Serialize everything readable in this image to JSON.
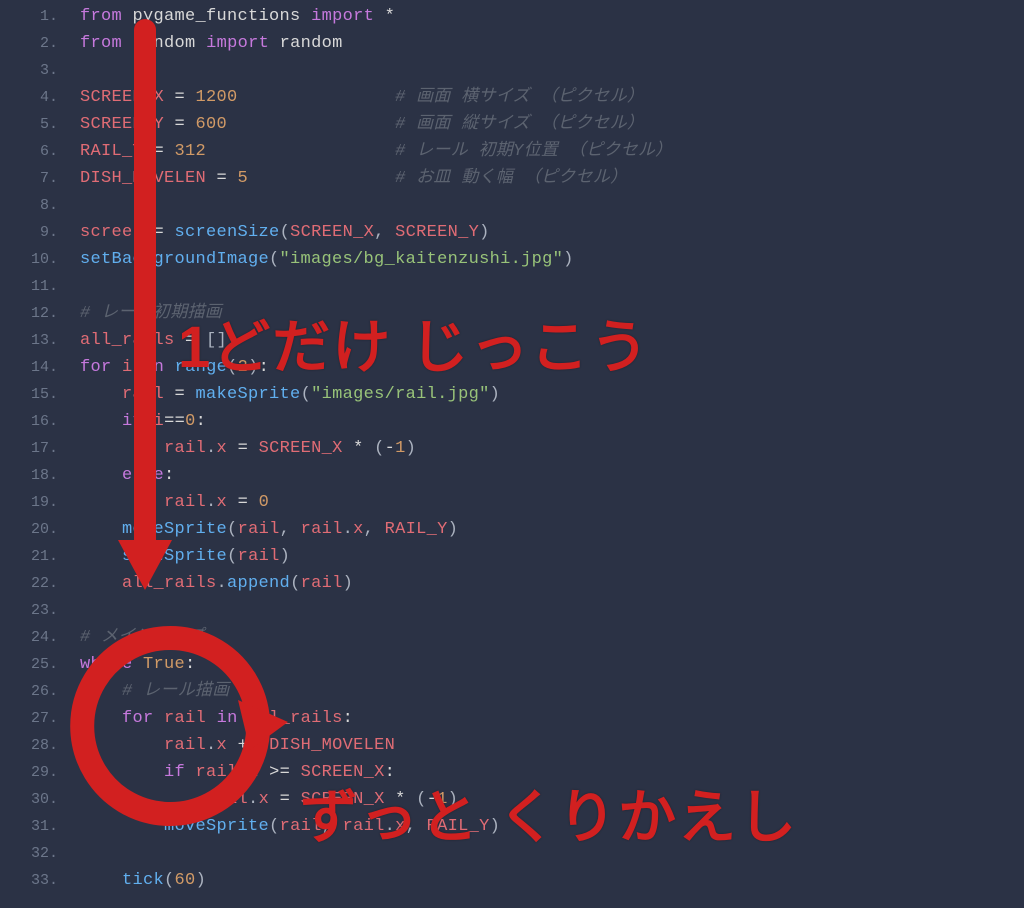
{
  "annotations": {
    "top": "1どだけ じっこう",
    "bottom": "ずっと くりかえし"
  },
  "lines": [
    {
      "n": "1.",
      "tokens": [
        [
          "kw",
          "from"
        ],
        [
          "op",
          " "
        ],
        [
          "mod",
          "pygame_functions"
        ],
        [
          "op",
          " "
        ],
        [
          "kw",
          "import"
        ],
        [
          "op",
          " "
        ],
        [
          "op",
          "*"
        ]
      ]
    },
    {
      "n": "2.",
      "tokens": [
        [
          "kw",
          "from"
        ],
        [
          "op",
          " "
        ],
        [
          "mod",
          "random"
        ],
        [
          "op",
          " "
        ],
        [
          "kw",
          "import"
        ],
        [
          "op",
          " "
        ],
        [
          "mod",
          "random"
        ]
      ]
    },
    {
      "n": "3.",
      "tokens": []
    },
    {
      "n": "4.",
      "tokens": [
        [
          "var",
          "SCREEN_X"
        ],
        [
          "op",
          " = "
        ],
        [
          "num",
          "1200"
        ],
        [
          "op",
          "               "
        ],
        [
          "cmt",
          "# 画面 横サイズ （ピクセル）"
        ]
      ]
    },
    {
      "n": "5.",
      "tokens": [
        [
          "var",
          "SCREEN_Y"
        ],
        [
          "op",
          " = "
        ],
        [
          "num",
          "600"
        ],
        [
          "op",
          "                "
        ],
        [
          "cmt",
          "# 画面 縦サイズ （ピクセル）"
        ]
      ]
    },
    {
      "n": "6.",
      "tokens": [
        [
          "var",
          "RAIL_Y"
        ],
        [
          "op",
          " = "
        ],
        [
          "num",
          "312"
        ],
        [
          "op",
          "                  "
        ],
        [
          "cmt",
          "# レール 初期Y位置 （ピクセル）"
        ]
      ]
    },
    {
      "n": "7.",
      "tokens": [
        [
          "var",
          "DISH_MOVELEN"
        ],
        [
          "op",
          " = "
        ],
        [
          "num",
          "5"
        ],
        [
          "op",
          "              "
        ],
        [
          "cmt",
          "# お皿 動く幅 （ピクセル）"
        ]
      ]
    },
    {
      "n": "8.",
      "tokens": []
    },
    {
      "n": "9.",
      "tokens": [
        [
          "var",
          "screen"
        ],
        [
          "op",
          " = "
        ],
        [
          "fn",
          "screenSize"
        ],
        [
          "punc",
          "("
        ],
        [
          "var",
          "SCREEN_X"
        ],
        [
          "punc",
          ", "
        ],
        [
          "var",
          "SCREEN_Y"
        ],
        [
          "punc",
          ")"
        ]
      ]
    },
    {
      "n": "10.",
      "tokens": [
        [
          "fn",
          "setBackgroundImage"
        ],
        [
          "punc",
          "("
        ],
        [
          "str",
          "\"images/bg_kaitenzushi.jpg\""
        ],
        [
          "punc",
          ")"
        ]
      ]
    },
    {
      "n": "11.",
      "tokens": []
    },
    {
      "n": "12.",
      "tokens": [
        [
          "cmt",
          "# レール初期描画"
        ]
      ]
    },
    {
      "n": "13.",
      "tokens": [
        [
          "var",
          "all_rails"
        ],
        [
          "op",
          " = "
        ],
        [
          "punc",
          "[]"
        ]
      ]
    },
    {
      "n": "14.",
      "tokens": [
        [
          "kw",
          "for"
        ],
        [
          "op",
          " "
        ],
        [
          "var",
          "i"
        ],
        [
          "op",
          " "
        ],
        [
          "kw",
          "in"
        ],
        [
          "op",
          " "
        ],
        [
          "fn",
          "range"
        ],
        [
          "punc",
          "("
        ],
        [
          "num",
          "2"
        ],
        [
          "punc",
          ")"
        ],
        [
          "op",
          ":"
        ]
      ]
    },
    {
      "n": "15.",
      "tokens": [
        [
          "op",
          "    "
        ],
        [
          "var",
          "rail"
        ],
        [
          "op",
          " = "
        ],
        [
          "fn",
          "makeSprite"
        ],
        [
          "punc",
          "("
        ],
        [
          "str",
          "\"images/rail.jpg\""
        ],
        [
          "punc",
          ")"
        ]
      ]
    },
    {
      "n": "16.",
      "tokens": [
        [
          "op",
          "    "
        ],
        [
          "kw",
          "if"
        ],
        [
          "op",
          " "
        ],
        [
          "var",
          "i"
        ],
        [
          "op",
          "=="
        ],
        [
          "num",
          "0"
        ],
        [
          "op",
          ":"
        ]
      ]
    },
    {
      "n": "17.",
      "tokens": [
        [
          "op",
          "        "
        ],
        [
          "var",
          "rail"
        ],
        [
          "punc",
          "."
        ],
        [
          "var",
          "x"
        ],
        [
          "op",
          " = "
        ],
        [
          "var",
          "SCREEN_X"
        ],
        [
          "op",
          " * "
        ],
        [
          "punc",
          "("
        ],
        [
          "op",
          "-"
        ],
        [
          "num",
          "1"
        ],
        [
          "punc",
          ")"
        ]
      ]
    },
    {
      "n": "18.",
      "tokens": [
        [
          "op",
          "    "
        ],
        [
          "kw",
          "else"
        ],
        [
          "op",
          ":"
        ]
      ]
    },
    {
      "n": "19.",
      "tokens": [
        [
          "op",
          "        "
        ],
        [
          "var",
          "rail"
        ],
        [
          "punc",
          "."
        ],
        [
          "var",
          "x"
        ],
        [
          "op",
          " = "
        ],
        [
          "num",
          "0"
        ]
      ]
    },
    {
      "n": "20.",
      "tokens": [
        [
          "op",
          "    "
        ],
        [
          "fn",
          "moveSprite"
        ],
        [
          "punc",
          "("
        ],
        [
          "var",
          "rail"
        ],
        [
          "punc",
          ", "
        ],
        [
          "var",
          "rail"
        ],
        [
          "punc",
          "."
        ],
        [
          "var",
          "x"
        ],
        [
          "punc",
          ", "
        ],
        [
          "var",
          "RAIL_Y"
        ],
        [
          "punc",
          ")"
        ]
      ]
    },
    {
      "n": "21.",
      "tokens": [
        [
          "op",
          "    "
        ],
        [
          "fn",
          "showSprite"
        ],
        [
          "punc",
          "("
        ],
        [
          "var",
          "rail"
        ],
        [
          "punc",
          ")"
        ]
      ]
    },
    {
      "n": "22.",
      "tokens": [
        [
          "op",
          "    "
        ],
        [
          "var",
          "all_rails"
        ],
        [
          "punc",
          "."
        ],
        [
          "fn",
          "append"
        ],
        [
          "punc",
          "("
        ],
        [
          "var",
          "rail"
        ],
        [
          "punc",
          ")"
        ]
      ]
    },
    {
      "n": "23.",
      "tokens": []
    },
    {
      "n": "24.",
      "tokens": [
        [
          "cmt",
          "# メインループ"
        ]
      ]
    },
    {
      "n": "25.",
      "tokens": [
        [
          "kw",
          "while"
        ],
        [
          "op",
          " "
        ],
        [
          "bool",
          "True"
        ],
        [
          "op",
          ":"
        ]
      ]
    },
    {
      "n": "26.",
      "tokens": [
        [
          "op",
          "    "
        ],
        [
          "cmt",
          "# レール描画"
        ]
      ]
    },
    {
      "n": "27.",
      "tokens": [
        [
          "op",
          "    "
        ],
        [
          "kw",
          "for"
        ],
        [
          "op",
          " "
        ],
        [
          "var",
          "rail"
        ],
        [
          "op",
          " "
        ],
        [
          "kw",
          "in"
        ],
        [
          "op",
          " "
        ],
        [
          "var",
          "all_rails"
        ],
        [
          "op",
          ":"
        ]
      ]
    },
    {
      "n": "28.",
      "tokens": [
        [
          "op",
          "        "
        ],
        [
          "var",
          "rail"
        ],
        [
          "punc",
          "."
        ],
        [
          "var",
          "x"
        ],
        [
          "op",
          " += "
        ],
        [
          "var",
          "DISH_MOVELEN"
        ]
      ]
    },
    {
      "n": "29.",
      "tokens": [
        [
          "op",
          "        "
        ],
        [
          "kw",
          "if"
        ],
        [
          "op",
          " "
        ],
        [
          "var",
          "rail"
        ],
        [
          "punc",
          "."
        ],
        [
          "var",
          "x"
        ],
        [
          "op",
          " >= "
        ],
        [
          "var",
          "SCREEN_X"
        ],
        [
          "op",
          ":"
        ]
      ]
    },
    {
      "n": "30.",
      "tokens": [
        [
          "op",
          "            "
        ],
        [
          "var",
          "rail"
        ],
        [
          "punc",
          "."
        ],
        [
          "var",
          "x"
        ],
        [
          "op",
          " = "
        ],
        [
          "var",
          "SCREEN_X"
        ],
        [
          "op",
          " * "
        ],
        [
          "punc",
          "("
        ],
        [
          "op",
          "-"
        ],
        [
          "num",
          "1"
        ],
        [
          "punc",
          ")"
        ]
      ]
    },
    {
      "n": "31.",
      "tokens": [
        [
          "op",
          "        "
        ],
        [
          "fn",
          "moveSprite"
        ],
        [
          "punc",
          "("
        ],
        [
          "var",
          "rail"
        ],
        [
          "punc",
          ", "
        ],
        [
          "var",
          "rail"
        ],
        [
          "punc",
          "."
        ],
        [
          "var",
          "x"
        ],
        [
          "punc",
          ", "
        ],
        [
          "var",
          "RAIL_Y"
        ],
        [
          "punc",
          ")"
        ]
      ]
    },
    {
      "n": "32.",
      "tokens": []
    },
    {
      "n": "33.",
      "tokens": [
        [
          "op",
          "    "
        ],
        [
          "fn",
          "tick"
        ],
        [
          "punc",
          "("
        ],
        [
          "num",
          "60"
        ],
        [
          "punc",
          ")"
        ]
      ]
    }
  ]
}
